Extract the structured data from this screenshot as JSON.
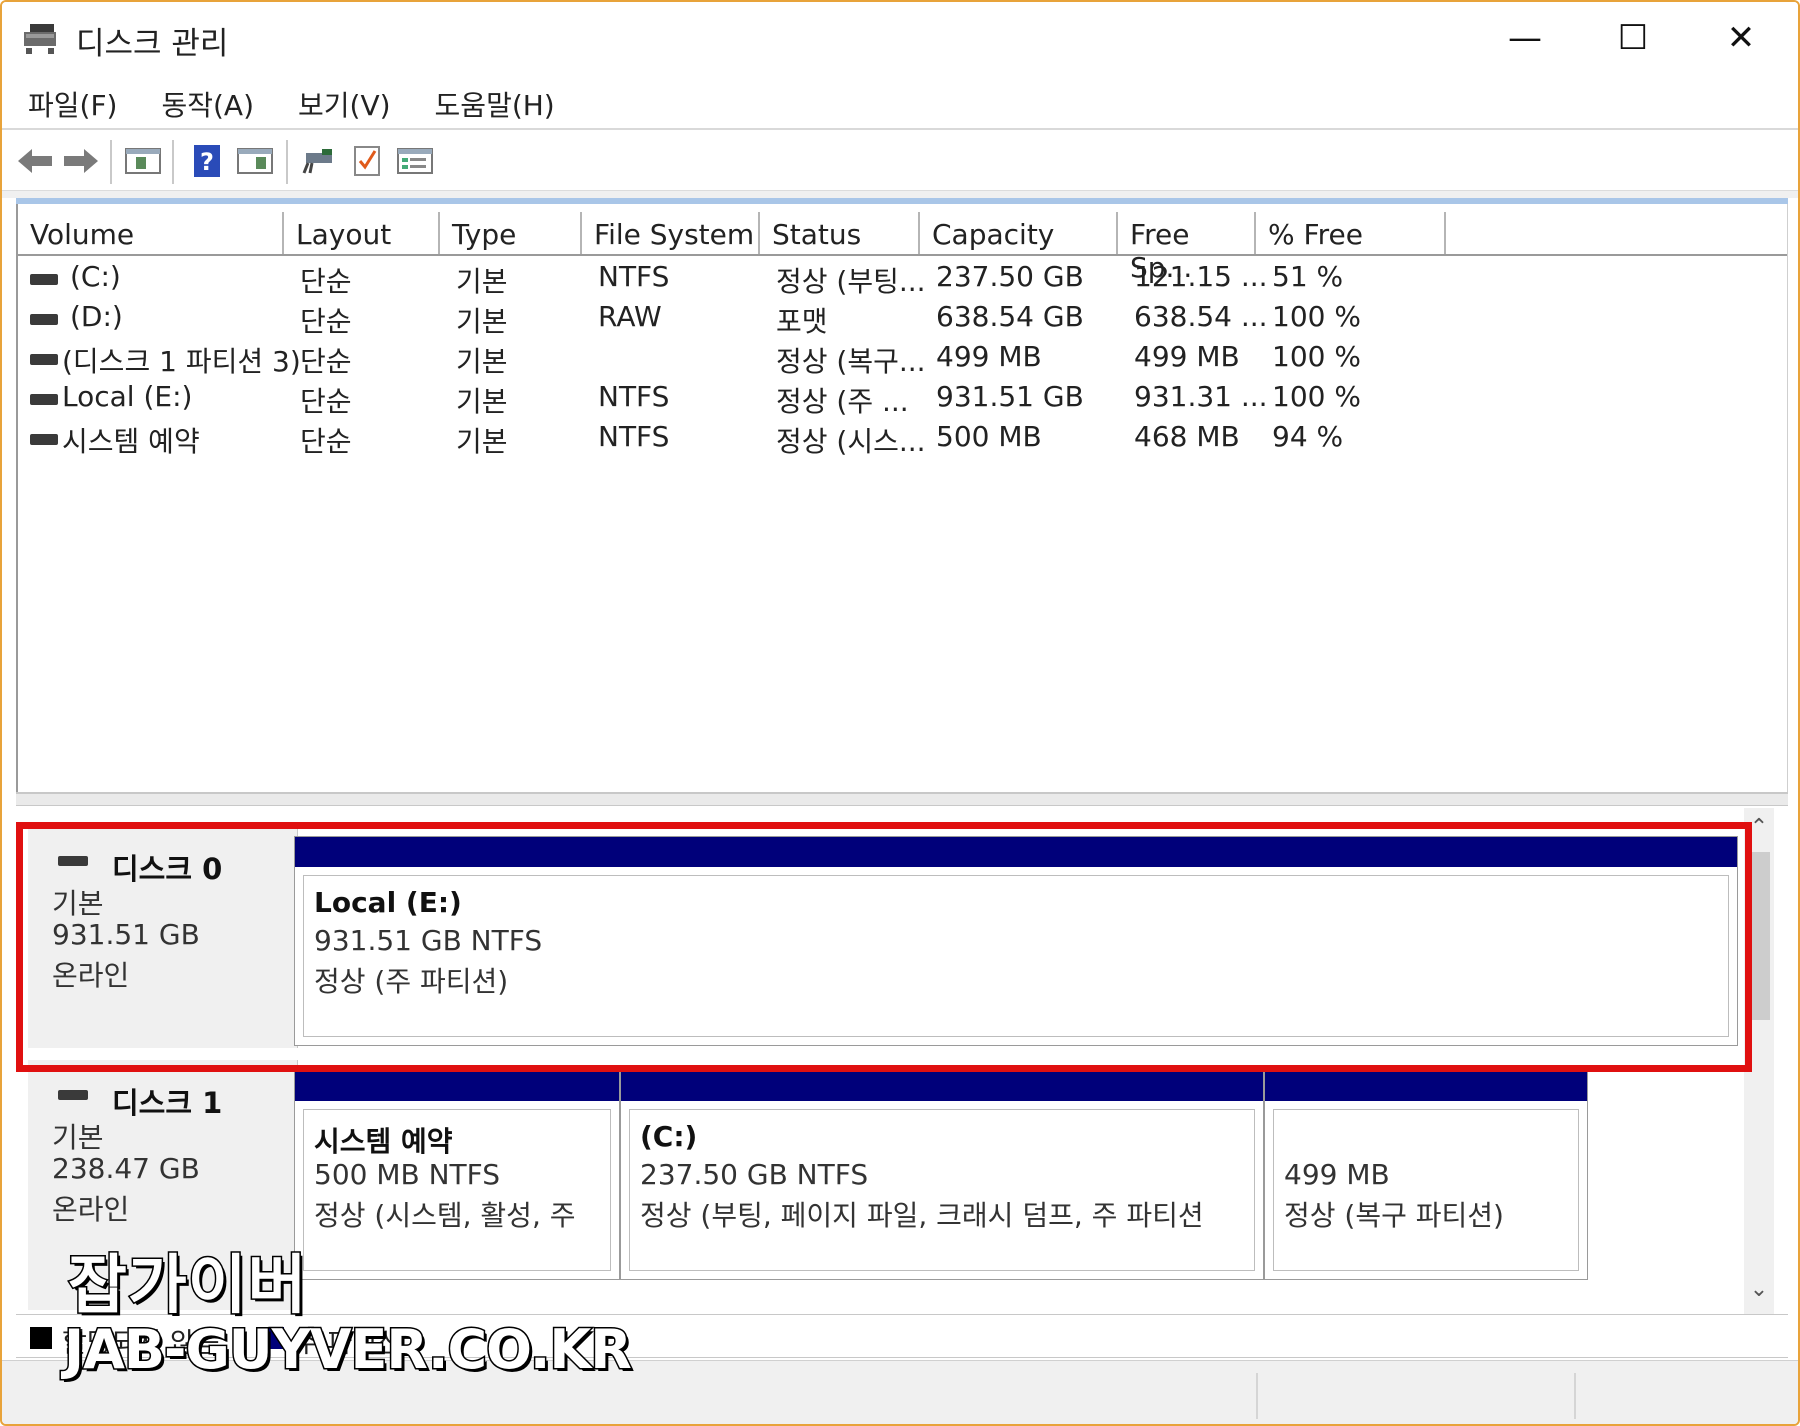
{
  "window": {
    "title": "디스크 관리",
    "minimize_label": "—",
    "maximize_label": "☐",
    "close_label": "✕"
  },
  "menu": [
    "파일(F)",
    "동작(A)",
    "보기(V)",
    "도움말(H)"
  ],
  "toolbar": {
    "icons": [
      "back-icon",
      "forward-icon",
      "console-tree-icon",
      "help-icon",
      "action-pane-icon",
      "connect-icon",
      "check-icon",
      "properties-icon"
    ]
  },
  "volume_list": {
    "columns": [
      "Volume",
      "Layout",
      "Type",
      "File System",
      "Status",
      "Capacity",
      "Free Sp...",
      "% Free"
    ],
    "rows": [
      {
        "volume": "(C:)",
        "layout": "단순",
        "type": "기본",
        "fs": "NTFS",
        "status": "정상 (부팅...",
        "capacity": "237.50 GB",
        "free": "121.15 ...",
        "pct": "51 %"
      },
      {
        "volume": "(D:)",
        "layout": "단순",
        "type": "기본",
        "fs": "RAW",
        "status": "포맷",
        "capacity": "638.54 GB",
        "free": "638.54 ...",
        "pct": "100 %"
      },
      {
        "volume": "(디스크 1 파티션 3)",
        "layout": "단순",
        "type": "기본",
        "fs": "",
        "status": "정상 (복구...",
        "capacity": "499 MB",
        "free": "499 MB",
        "pct": "100 %"
      },
      {
        "volume": "Local (E:)",
        "layout": "단순",
        "type": "기본",
        "fs": "NTFS",
        "status": "정상 (주 ...",
        "capacity": "931.51 GB",
        "free": "931.31 ...",
        "pct": "100 %"
      },
      {
        "volume": "시스템 예약",
        "layout": "단순",
        "type": "기본",
        "fs": "NTFS",
        "status": "정상 (시스...",
        "capacity": "500 MB",
        "free": "468 MB",
        "pct": "94 %"
      }
    ]
  },
  "disks": [
    {
      "name": "디스크 0",
      "type": "기본",
      "size": "931.51 GB",
      "state": "온라인",
      "partitions": [
        {
          "name": "Local  (E:)",
          "size": "931.51 GB NTFS",
          "status": "정상 (주 파티션)"
        }
      ]
    },
    {
      "name": "디스크 1",
      "type": "기본",
      "size": "238.47 GB",
      "state": "온라인",
      "partitions": [
        {
          "name": "시스템 예약",
          "size": "500 MB NTFS",
          "status": "정상 (시스템, 활성, 주"
        },
        {
          "name": "(C:)",
          "size": "237.50 GB NTFS",
          "status": "정상 (부팅, 페이지 파일, 크래시 덤프, 주 파티션"
        },
        {
          "name": "",
          "size": "499 MB",
          "status": "정상 (복구 파티션)"
        }
      ]
    }
  ],
  "legend": [
    {
      "label": "할당되지 않음",
      "color": "#000000"
    },
    {
      "label": "주 파티션",
      "color": "#00007a"
    }
  ],
  "colors": {
    "partition_bar": "#00007a",
    "highlight": "#e01010",
    "window_border": "#e8a33a"
  },
  "watermark": {
    "line1": "잡가이버",
    "line2": "JAB-GUYVER.CO.KR"
  }
}
